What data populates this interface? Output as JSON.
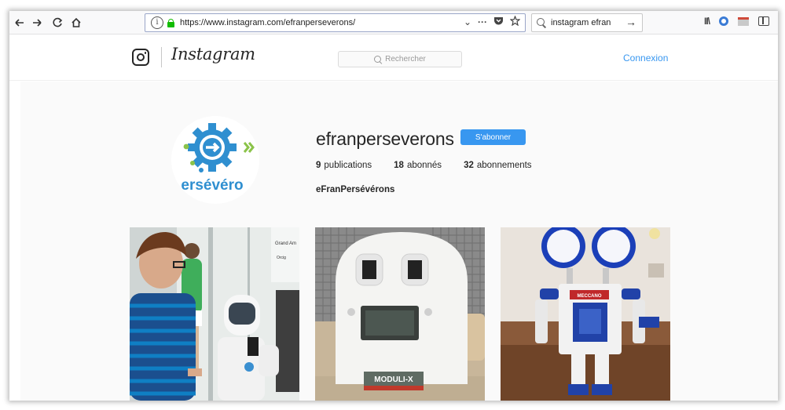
{
  "browser": {
    "url": "https://www.instagram.com/efranperseverons/",
    "search_query": "instagram efran",
    "icons": [
      "back-arrow-icon",
      "forward-arrow-icon",
      "reload-icon",
      "home-icon",
      "info-icon",
      "lock-icon",
      "dropdown-icon",
      "page-actions-icon",
      "pocket-icon",
      "bookmark-star-icon",
      "search-icon",
      "go-arrow-icon",
      "library-icon",
      "extension-icon",
      "screenshot-icon",
      "sidebar-icon"
    ]
  },
  "header": {
    "logo_text": "Instagram",
    "search_placeholder": "Rechercher",
    "login_label": "Connexion"
  },
  "profile": {
    "avatar_text": "ersévéro",
    "username": "efranperseverons",
    "follow_label": "S'abonner",
    "posts_count": "9",
    "posts_label": "publications",
    "followers_count": "18",
    "followers_label": "abonnés",
    "following_count": "32",
    "following_label": "abonnements",
    "full_name": "eFranPersévérons"
  },
  "posts": [
    {
      "description": "child-with-robot",
      "caption_tags": [
        "Grand Am",
        "Orcig"
      ]
    },
    {
      "description": "white-robot-face",
      "label": "MODULI-X"
    },
    {
      "description": "meccano-robot",
      "label": "MECCANO"
    }
  ],
  "colors": {
    "accent": "#3897f0",
    "logo_blue": "#2f8fd0",
    "logo_green": "#8bc34a"
  }
}
